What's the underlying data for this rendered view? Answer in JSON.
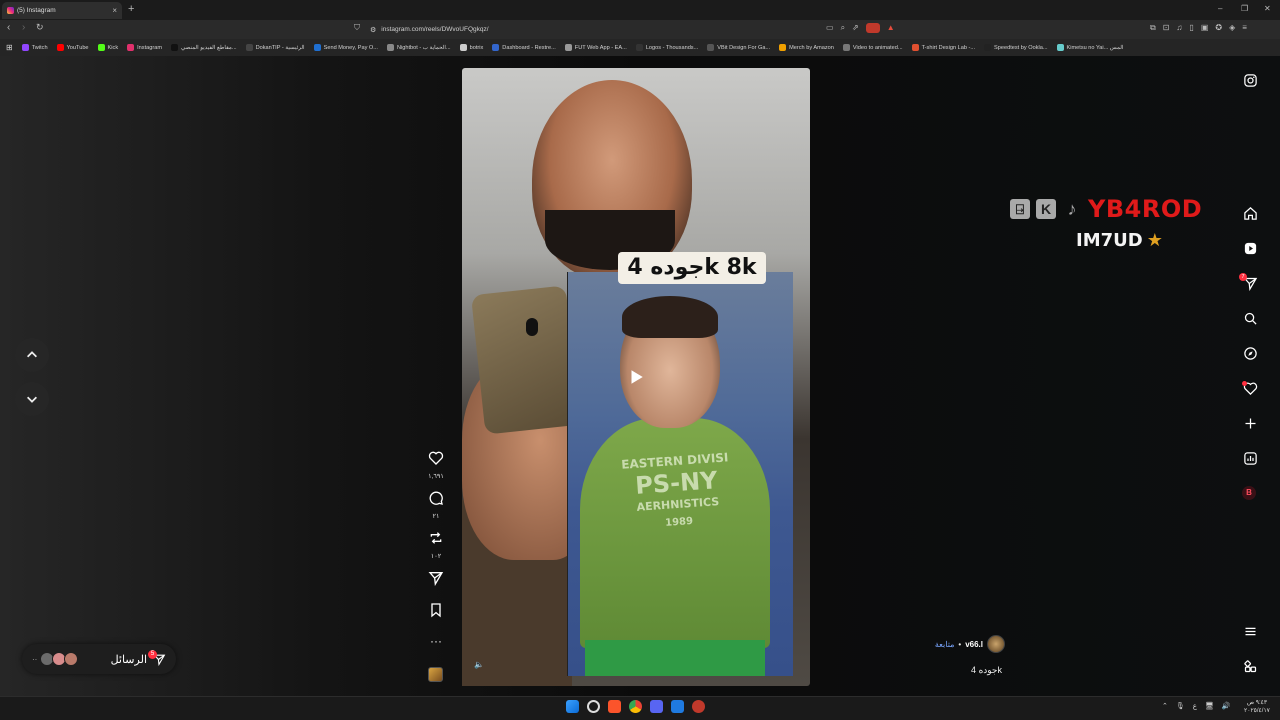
{
  "browser": {
    "tab_title": "(5) Instagram",
    "new_tab": "+",
    "url": "instagram.com/reels/DWvoUFQgkqz/",
    "win_minimize": "–",
    "win_restore": "❐",
    "win_close": "✕"
  },
  "bookmarks": [
    {
      "label": "Twitch",
      "color": "#9146ff"
    },
    {
      "label": "YouTube",
      "color": "#ff0000"
    },
    {
      "label": "Kick",
      "color": "#53fc18"
    },
    {
      "label": "Instagram",
      "color": "#e1306c"
    },
    {
      "label": "مقاطع الفيديو المنصي...",
      "color": "#111111"
    },
    {
      "label": "DokanTIP - الرئيسية",
      "color": "#444444"
    },
    {
      "label": "Send Money, Pay O...",
      "color": "#1f6fd1"
    },
    {
      "label": "Nightbot - الحماية ب...",
      "color": "#888888"
    },
    {
      "label": "botrix",
      "color": "#cccccc"
    },
    {
      "label": "Dashboard - Restre...",
      "color": "#3366cc"
    },
    {
      "label": "FUT Web App - EA...",
      "color": "#999999"
    },
    {
      "label": "Logos - Thousands...",
      "color": "#333333"
    },
    {
      "label": "VBit Design For Ga...",
      "color": "#555555"
    },
    {
      "label": "Merch by Amazon",
      "color": "#f0a000"
    },
    {
      "label": "Video to animated...",
      "color": "#777777"
    },
    {
      "label": "T-shirt Design Lab -...",
      "color": "#e05030"
    },
    {
      "label": "Speedtest by Ookla...",
      "color": "#222222"
    },
    {
      "label": "Kimetsu no Yai... المس",
      "color": "#66cccc"
    }
  ],
  "video": {
    "overlay_text": "جوده 4k 8k",
    "shirt_text_line1": "EASTERN DIVISI",
    "shirt_text_line2": "PS-NY",
    "shirt_text_line3": "AERHNISTICS",
    "shirt_text_line4": "1989"
  },
  "actions": {
    "likes": "١,٦٩١",
    "comments": "٢١",
    "reposts": "١٠٢"
  },
  "messages": {
    "label": "الرسائل",
    "badge": "5"
  },
  "right_nav": {
    "notifications_badge": "7",
    "b_label": "B"
  },
  "streamer_overlay": {
    "name_red": "YB4ROD",
    "name_white": "IM7UD",
    "star": "★",
    "k_icon": "K",
    "twitch_icon": "⍈",
    "tiktok_icon": "♪"
  },
  "author": {
    "username": "v66.l",
    "separator": "•",
    "follow": "متابعة",
    "caption": "جوده 4k"
  },
  "taskbar": {
    "clock_time": "٩:٤٣ ص",
    "clock_date": "٢٠٢٥/٤/١٧",
    "lang": "ع"
  },
  "colors": {
    "accent_red": "#ff3040",
    "follow_blue": "#7aa6ff",
    "streamer_red": "#e01a1a"
  }
}
